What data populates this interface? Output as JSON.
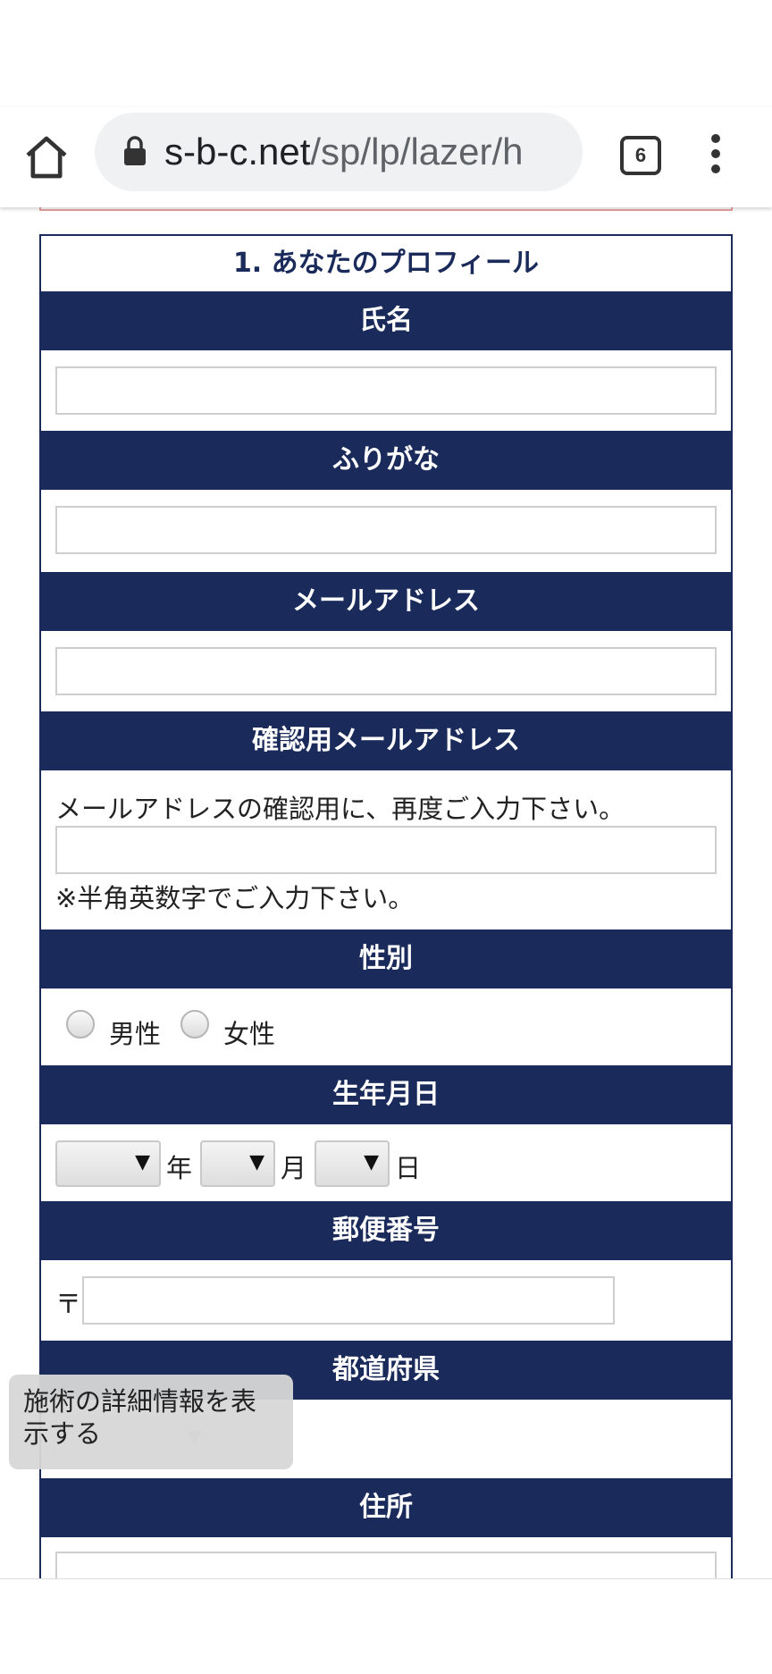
{
  "browser": {
    "url_domain": "s-b-c.net",
    "url_path": "/sp/lp/lazer/h",
    "tab_count": "6",
    "home_icon": "home-icon",
    "lock_icon": "lock-icon",
    "menu_icon": "more-vert-icon"
  },
  "form": {
    "section_title": "1. あなたのプロフィール",
    "name_label": "氏名",
    "furigana_label": "ふりがな",
    "email_label": "メールアドレス",
    "email_confirm_label": "確認用メールアドレス",
    "email_confirm_note": "メールアドレスの確認用に、再度ご入力下さい。",
    "email_confirm_hint": "※半角英数字でご入力下さい。",
    "gender_label": "性別",
    "gender_male": "男性",
    "gender_female": "女性",
    "birthday_label": "生年月日",
    "year_unit": "年",
    "month_unit": "月",
    "day_unit": "日",
    "postal_label": "郵便番号",
    "postal_mark": "〒",
    "prefecture_label": "都道府県",
    "address_label": "住所"
  },
  "tooltip": {
    "text": "施術の詳細情報を表示する"
  },
  "colors": {
    "header_bg": "#1a2a5a",
    "header_text": "#ffffff"
  }
}
